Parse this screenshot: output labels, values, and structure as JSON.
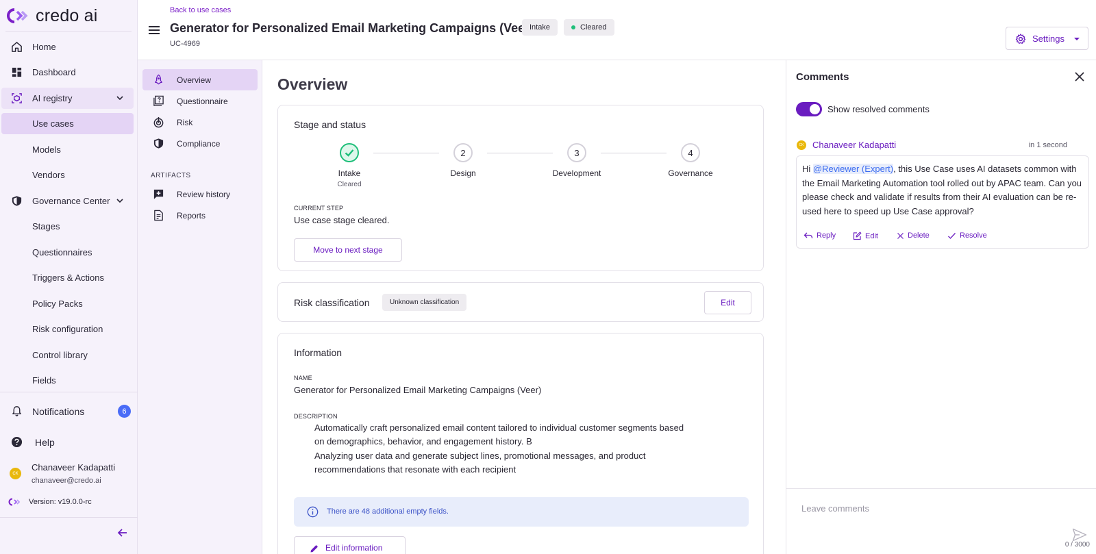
{
  "brand": {
    "name": "credo ai",
    "accent": "#6a1cc0"
  },
  "sidebar": {
    "items": [
      {
        "label": "Home",
        "icon": "home-icon"
      },
      {
        "label": "Dashboard",
        "icon": "dashboard-icon"
      },
      {
        "label": "AI registry",
        "icon": "registry-icon",
        "expanded": true
      },
      {
        "label": "Use cases",
        "active": true
      },
      {
        "label": "Models"
      },
      {
        "label": "Vendors"
      },
      {
        "label": "Governance Center",
        "icon": "shield-icon",
        "expanded": true
      },
      {
        "label": "Stages"
      },
      {
        "label": "Questionnaires"
      },
      {
        "label": "Triggers & Actions"
      },
      {
        "label": "Policy Packs"
      },
      {
        "label": "Risk configuration"
      },
      {
        "label": "Control library"
      },
      {
        "label": "Fields"
      }
    ],
    "notifications": {
      "label": "Notifications",
      "count": "6"
    },
    "help": {
      "label": "Help"
    },
    "user": {
      "initials": "CK",
      "name": "Chanaveer Kadapatti",
      "email": "chanaveer@credo.ai"
    },
    "version": "Version: v19.0.0-rc"
  },
  "header": {
    "back_link": "Back to use cases",
    "title": "Generator for Personalized Email Marketing Campaigns (Veer)",
    "id": "UC-4969",
    "chip_stage": "Intake",
    "chip_status": "Cleared",
    "settings_label": "Settings"
  },
  "subnav": {
    "items": [
      {
        "label": "Overview",
        "icon": "rocket-icon",
        "active": true
      },
      {
        "label": "Questionnaire",
        "icon": "questionnaire-icon"
      },
      {
        "label": "Risk",
        "icon": "target-icon"
      },
      {
        "label": "Compliance",
        "icon": "shield-icon"
      }
    ],
    "artifacts_header": "ARTIFACTS",
    "artifacts": [
      {
        "label": "Review history",
        "icon": "review-icon"
      },
      {
        "label": "Reports",
        "icon": "report-icon"
      }
    ]
  },
  "main": {
    "title": "Overview",
    "stage": {
      "card_title": "Stage and status",
      "steps": [
        {
          "num": "1",
          "name": "Intake",
          "sub": "Cleared",
          "done": true
        },
        {
          "num": "2",
          "name": "Design",
          "sub": ""
        },
        {
          "num": "3",
          "name": "Development",
          "sub": ""
        },
        {
          "num": "4",
          "name": "Governance",
          "sub": ""
        }
      ],
      "current_step_label": "CURRENT STEP",
      "current_step_value": "Use case stage cleared.",
      "move_button": "Move to next stage"
    },
    "risk": {
      "title": "Risk classification",
      "chip": "Unknown classification",
      "edit_button": "Edit"
    },
    "info": {
      "title": "Information",
      "name_label": "NAME",
      "name_value": "Generator for Personalized Email Marketing Campaigns (Veer)",
      "desc_label": "DESCRIPTION",
      "desc_lines": [
        "Automatically craft personalized email content tailored to individual customer segments based",
        "on demographics, behavior, and engagement history. B",
        "Analyzing user data and generate subject lines, promotional messages, and product",
        "recommendations that resonate with each recipient"
      ],
      "empty_banner": "There are 48 additional empty fields.",
      "edit_button": "Edit information"
    }
  },
  "comments": {
    "title": "Comments",
    "toggle_label": "Show resolved comments",
    "toggle_on": true,
    "comment": {
      "author_initials": "CK",
      "author": "Chanaveer Kadapatti",
      "time": "in 1 second",
      "text_before": "Hi ",
      "mention": "@Reviewer (Expert)",
      "text_after": ", this Use Case uses AI datasets common with the Email Marketing Automation tool rolled out by APAC team. Can you please check and validate if results from their AI evaluation can be re-used here to speed up Use Case approval?",
      "actions": [
        "Reply",
        "Edit",
        "Delete",
        "Resolve"
      ]
    },
    "input_placeholder": "Leave comments",
    "char_count": "0 / 3000"
  }
}
